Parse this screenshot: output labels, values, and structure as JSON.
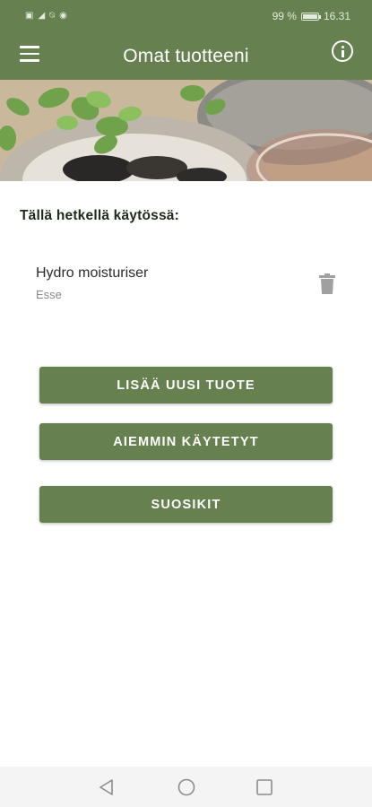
{
  "status_bar": {
    "left_icons": [
      "sim-icon",
      "signal-icon",
      "mute-icon",
      "sync-icon"
    ],
    "battery_percent": "99 %",
    "time": "16.31"
  },
  "app_bar": {
    "title": "Omat tuotteeni",
    "menu_icon": "hamburger-menu-icon",
    "info_icon": "info-icon"
  },
  "banner": {
    "description_icon": "plants-and-stones-photo"
  },
  "current_section": {
    "heading": "Tällä hetkellä käytössä:",
    "items": [
      {
        "name": "Hydro moisturiser",
        "brand": "Esse",
        "action_icon": "trash-icon"
      }
    ]
  },
  "actions": {
    "add_new": "LISÄÄ UUSI TUOTE",
    "previously_used": "AIEMMIN KÄYTETYT",
    "favorites": "SUOSIKIT"
  },
  "nav_bar": {
    "back_icon": "back-triangle-icon",
    "home_icon": "home-circle-icon",
    "recents_icon": "recents-square-icon"
  },
  "colors": {
    "primary": "#66804f",
    "text_dark": "#1f2a18",
    "text_secondary": "#8a8a8a",
    "icon_gray": "#a0a0a0"
  }
}
